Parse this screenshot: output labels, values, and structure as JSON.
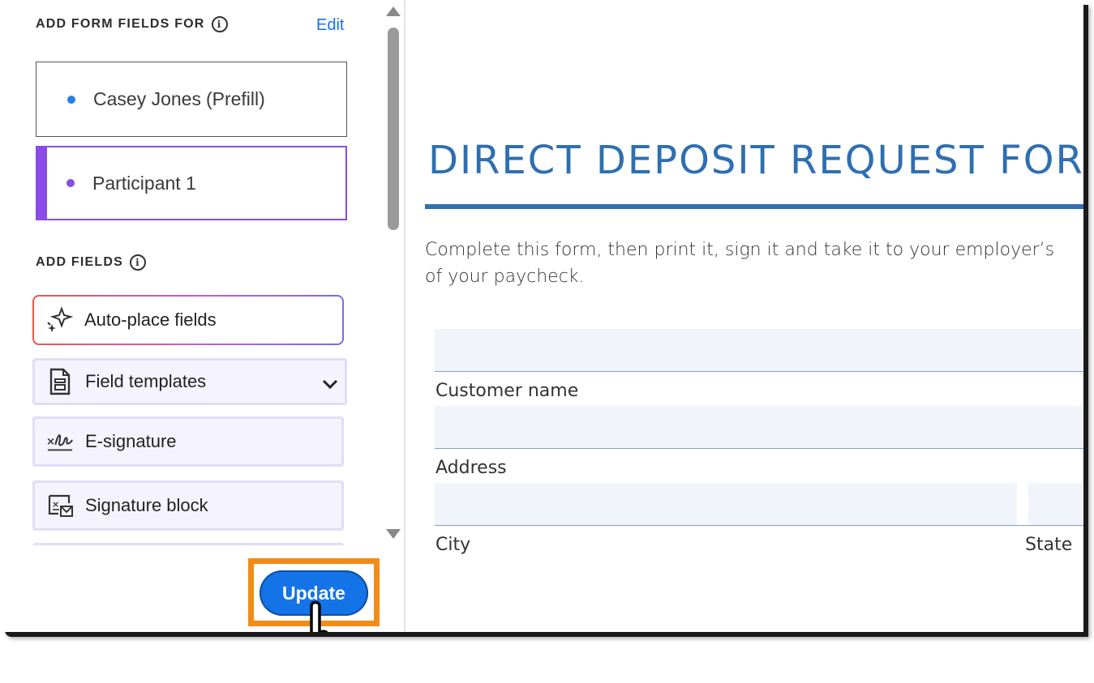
{
  "panel": {
    "recipients_title": "ADD FORM FIELDS FOR",
    "edit_label": "Edit",
    "recipients": [
      {
        "name": "Casey Jones",
        "role": "(Prefill)",
        "color": "#2680eb"
      },
      {
        "name": "Participant 1",
        "role": "",
        "color": "#8a4be8"
      }
    ],
    "fields_title": "ADD FIELDS",
    "fields": [
      {
        "label": "Auto-place fields",
        "icon": "sparkle-icon"
      },
      {
        "label": "Field templates",
        "icon": "document-template-icon"
      },
      {
        "label": "E-signature",
        "icon": "signature-icon"
      },
      {
        "label": "Signature block",
        "icon": "signature-block-icon"
      }
    ],
    "update_label": "Update",
    "highlight_color": "#f28c18",
    "accent_color": "#1473e6"
  },
  "document": {
    "title": "DIRECT DEPOSIT REQUEST FORM",
    "intro_line1": "Complete this form, then print it, sign it and take it to your employer’s",
    "intro_line2": "of your paycheck.",
    "fields": {
      "customer_name": "Customer name",
      "address": "Address",
      "city": "City",
      "state": "State"
    }
  }
}
